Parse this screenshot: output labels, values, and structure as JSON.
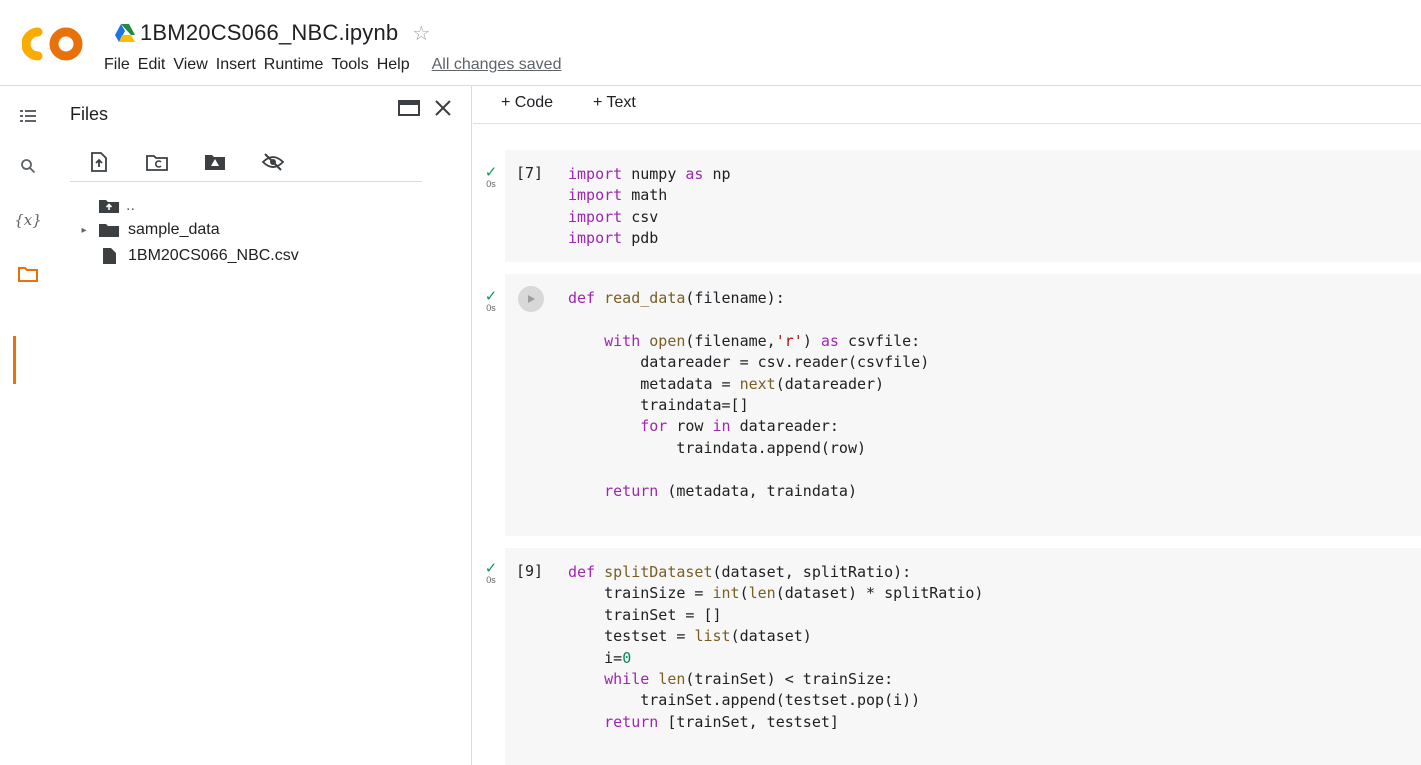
{
  "header": {
    "title": "1BM20CS066_NBC.ipynb",
    "star_icon": "☆",
    "menu": [
      "File",
      "Edit",
      "View",
      "Insert",
      "Runtime",
      "Tools",
      "Help"
    ],
    "save_status": "All changes saved",
    "logo_text": "CO",
    "colors": {
      "logo_left": "#f9ab00",
      "logo_right": "#e8710a"
    }
  },
  "rail": {
    "items": [
      "table-of-contents-icon",
      "search-icon",
      "variables-icon",
      "files-icon"
    ],
    "variables_label": "{x}",
    "active_color": "#e8710a"
  },
  "files_panel": {
    "title": "Files",
    "toolbar": [
      "upload-file-icon",
      "refresh-icon",
      "mount-drive-icon",
      "hide-files-icon"
    ],
    "tree": [
      {
        "label": "..",
        "type": "parent-folder"
      },
      {
        "label": "sample_data",
        "type": "folder"
      },
      {
        "label": "1BM20CS066_NBC.csv",
        "type": "file"
      }
    ]
  },
  "toolbar": {
    "add_code": "+ Code",
    "add_text": "+ Text"
  },
  "cells": [
    {
      "exec_count": "[7]",
      "time": "0s",
      "code": [
        [
          [
            "kw",
            "import"
          ],
          [
            "t",
            " numpy "
          ],
          [
            "kw",
            "as"
          ],
          [
            "t",
            " np"
          ]
        ],
        [
          [
            "kw",
            "import"
          ],
          [
            "t",
            " math"
          ]
        ],
        [
          [
            "kw",
            "import"
          ],
          [
            "t",
            " csv"
          ]
        ],
        [
          [
            "kw",
            "import"
          ],
          [
            "t",
            " pdb"
          ]
        ]
      ]
    },
    {
      "exec_count": "",
      "time": "0s",
      "code": [
        [
          [
            "kw",
            "def"
          ],
          [
            "t",
            " "
          ],
          [
            "fn",
            "read_data"
          ],
          [
            "t",
            "(filename):"
          ]
        ],
        [
          [
            "t",
            ""
          ]
        ],
        [
          [
            "t",
            "    "
          ],
          [
            "kw",
            "with"
          ],
          [
            "t",
            " "
          ],
          [
            "bi",
            "open"
          ],
          [
            "t",
            "(filename,"
          ],
          [
            "str",
            "'r'"
          ],
          [
            "t",
            ") "
          ],
          [
            "kw",
            "as"
          ],
          [
            "t",
            " csvfile:"
          ]
        ],
        [
          [
            "t",
            "        datareader = csv.reader(csvfile)"
          ]
        ],
        [
          [
            "t",
            "        metadata = "
          ],
          [
            "bi",
            "next"
          ],
          [
            "t",
            "(datareader)"
          ]
        ],
        [
          [
            "t",
            "        traindata=[]"
          ]
        ],
        [
          [
            "t",
            "        "
          ],
          [
            "kw",
            "for"
          ],
          [
            "t",
            " row "
          ],
          [
            "kw",
            "in"
          ],
          [
            "t",
            " datareader:"
          ]
        ],
        [
          [
            "t",
            "            traindata.append(row)"
          ]
        ],
        [
          [
            "t",
            ""
          ]
        ],
        [
          [
            "t",
            "    "
          ],
          [
            "kw",
            "return"
          ],
          [
            "t",
            " (metadata, traindata)"
          ]
        ]
      ]
    },
    {
      "exec_count": "[9]",
      "time": "0s",
      "code": [
        [
          [
            "kw",
            "def"
          ],
          [
            "t",
            " "
          ],
          [
            "fn",
            "splitDataset"
          ],
          [
            "t",
            "(dataset, splitRatio):"
          ]
        ],
        [
          [
            "t",
            "    trainSize = "
          ],
          [
            "bi",
            "int"
          ],
          [
            "t",
            "("
          ],
          [
            "bi",
            "len"
          ],
          [
            "t",
            "(dataset) * splitRatio)"
          ]
        ],
        [
          [
            "t",
            "    trainSet = []"
          ]
        ],
        [
          [
            "t",
            "    testset = "
          ],
          [
            "bi",
            "list"
          ],
          [
            "t",
            "(dataset)"
          ]
        ],
        [
          [
            "t",
            "    i="
          ],
          [
            "num",
            "0"
          ]
        ],
        [
          [
            "t",
            "    "
          ],
          [
            "kw",
            "while"
          ],
          [
            "t",
            " "
          ],
          [
            "bi",
            "len"
          ],
          [
            "t",
            "(trainSet) < trainSize:"
          ]
        ],
        [
          [
            "t",
            "        trainSet.append(testset.pop(i))"
          ]
        ],
        [
          [
            "t",
            "    "
          ],
          [
            "kw",
            "return"
          ],
          [
            "t",
            " [trainSet, testset]"
          ]
        ]
      ]
    }
  ]
}
